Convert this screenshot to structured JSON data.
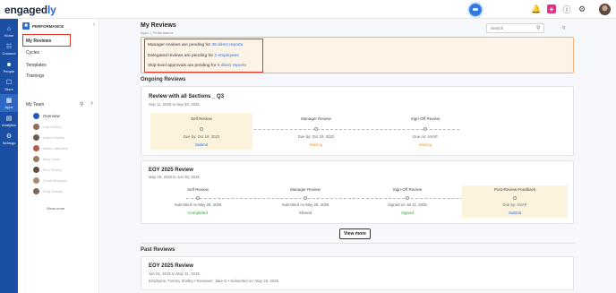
{
  "app": {
    "logo_main": "engaged",
    "logo_accent": "ly"
  },
  "topbar": {
    "icons": [
      "bell-icon",
      "plus-icon",
      "help-icon",
      "settings-icon",
      "avatar"
    ]
  },
  "rail": {
    "items": [
      {
        "label": "Home",
        "icon": "home-icon"
      },
      {
        "label": "Connect",
        "icon": "connect-icon"
      },
      {
        "label": "People",
        "icon": "people-icon"
      },
      {
        "label": "Store",
        "icon": "store-icon"
      },
      {
        "label": "Apps",
        "icon": "apps-icon"
      },
      {
        "label": "Analytics",
        "icon": "analytics-icon"
      },
      {
        "label": "Settings",
        "icon": "settings-icon"
      }
    ]
  },
  "sidebar": {
    "heading": "PERFORMANCE",
    "items": [
      {
        "label": "My Reviews"
      },
      {
        "label": "Cycles"
      },
      {
        "label": "Templates"
      },
      {
        "label": "Trainings"
      }
    ],
    "my_team": "My Team",
    "overview": "Overview",
    "team_members": [
      "Ada Shelby",
      "Arthur Shelby",
      "Arlete Valentine",
      "Blue Circle",
      "Finn Shelby",
      "Grace Burgess",
      "Polly Shelby"
    ],
    "show_more": "Show more"
  },
  "page": {
    "title": "My Reviews",
    "breadcrumb": "Apps > Performance",
    "search_placeholder": "Search"
  },
  "banner": {
    "line1_prefix": "Manager reviews are pending for ",
    "line1_link": "39 direct reports",
    "line2_prefix": "Delegated reviews are pending for ",
    "line2_link": "2 employees",
    "line3_prefix": "Skip-level approvals are pending for ",
    "line3_link": "5 direct reports"
  },
  "ongoing": {
    "heading": "Ongoing Reviews",
    "cards": [
      {
        "title": "Review with all Sections _ Q3",
        "dates": "Sep 11, 2025 to Sep 30, 2025",
        "stages": [
          {
            "name": "Self Review",
            "due": "Due by: Oct 19, 2022",
            "action": "Submit"
          },
          {
            "name": "Manager Review",
            "due": "Due by: Oct 19, 2022",
            "action": "Waiting"
          },
          {
            "name": "Sign-Off Review",
            "due": "Due on: ASAP",
            "action": "Waiting"
          }
        ]
      },
      {
        "title": "EOY 2025 Review",
        "dates": "May 29, 2025 to Jun 30, 2025",
        "stages": [
          {
            "name": "Self Review",
            "due": "Submitted on May 29, 2025",
            "action": "Completed"
          },
          {
            "name": "Manager Review",
            "due": "Submitted on May 29, 2025",
            "action": "Shared"
          },
          {
            "name": "Sign-Off Review",
            "due": "Signed on Jul 11, 2025",
            "action": "Signed"
          },
          {
            "name": "Post-Review Feedback",
            "due": "Due by: ASAP",
            "action": "Submit"
          }
        ]
      }
    ],
    "view_more": "View more"
  },
  "past": {
    "heading": "Past Reviews",
    "cards": [
      {
        "title": "EOY 2025 Review",
        "dates": "Jan 01, 2025 to May 31, 2025",
        "meta": "Employee: Tommy Shelby  •  Reviewer: Jake G  •  Submitted on: May 29, 2025"
      }
    ]
  },
  "colors": {
    "rail": "#1a4fa3",
    "link": "#2b6cd4",
    "waiting": "#e8a23a",
    "complete": "#3b9a3b",
    "banner_bg": "#fdf3e6",
    "highlight": "#e0392b"
  }
}
